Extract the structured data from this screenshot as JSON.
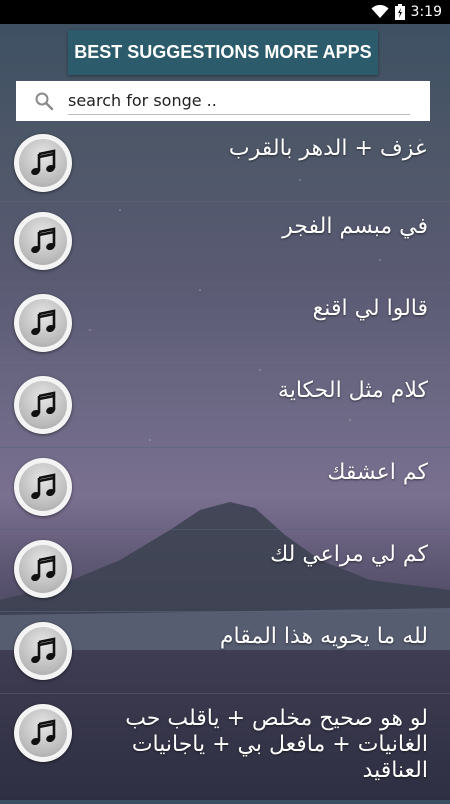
{
  "status_bar": {
    "time": "3:19",
    "wifi_icon": "wifi-icon",
    "battery_icon": "battery-icon"
  },
  "header": {
    "button_label": "BEST SUGGESTIONS MORE APPS",
    "button_color": "#2c5c6b"
  },
  "search": {
    "placeholder": "search for songe ..",
    "value": "search for songe ..",
    "icon": "search-icon"
  },
  "songs": [
    {
      "title": "عزف + الدهر بالقرب",
      "icon": "music-note-icon"
    },
    {
      "title": "في مبسم الفجر",
      "icon": "music-note-icon"
    },
    {
      "title": "قالوا لي اقنع",
      "icon": "music-note-icon"
    },
    {
      "title": "كلام مثل الحكاية",
      "icon": "music-note-icon"
    },
    {
      "title": "كم اعشقك",
      "icon": "music-note-icon"
    },
    {
      "title": "كم لي مراعي لك",
      "icon": "music-note-icon"
    },
    {
      "title": "لله ما يحويه هذا المقام",
      "icon": "music-note-icon"
    },
    {
      "title": "لو هو صحيح مخلص + ياقلب حب الغانيات + مافعل بي + ياجانيات العناقيد",
      "icon": "music-note-icon"
    }
  ]
}
